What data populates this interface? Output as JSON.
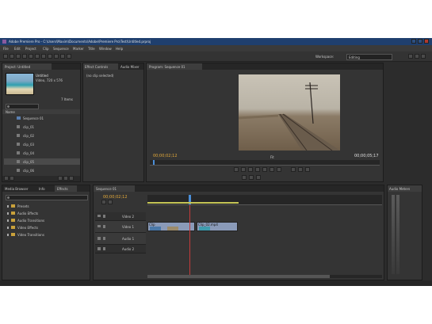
{
  "window": {
    "title": "Adobe Premiere Pro - C:\\Users\\Maxim\\Documents\\Adobe\\Premiere Pro\\Test\\Untitled.prproj"
  },
  "menu": [
    "File",
    "Edit",
    "Project",
    "Clip",
    "Sequence",
    "Marker",
    "Title",
    "Window",
    "Help"
  ],
  "workspace": {
    "label": "Workspace:",
    "value": "Editing"
  },
  "project": {
    "tabs": [
      "Project: Untitled",
      "Media Browser",
      "Info",
      "Effects"
    ],
    "clip_name": "Untitled",
    "clip_info": "Video, 720 x 576",
    "items_count": "7 Items",
    "col_name": "Name",
    "items": [
      "Sequence 01",
      "clip_01",
      "clip_02",
      "clip_03",
      "clip_04",
      "clip_05",
      "clip_06"
    ]
  },
  "effect_controls": {
    "tabs": [
      "Effect Controls",
      "Audio Mixer"
    ],
    "empty": "(no clip selected)"
  },
  "program": {
    "tab": "Program: Sequence 01",
    "timecode": "00;00;02;12",
    "duration": "00;00;05;17",
    "fit": "Fit"
  },
  "effects": {
    "tabs": [
      "Media Browser",
      "Info",
      "Effects"
    ],
    "folders": [
      "Presets",
      "Audio Effects",
      "Audio Transitions",
      "Video Effects",
      "Video Transitions"
    ]
  },
  "timeline": {
    "tab": "Sequence 01",
    "timecode": "00;00;02;12",
    "tracks": [
      "Video 2",
      "Video 1",
      "Audio 1",
      "Audio 2"
    ],
    "clip1": "Clip",
    "clip2": "Clip_02.mp4"
  },
  "audio_meters": {
    "tab": "Audio Meters"
  }
}
